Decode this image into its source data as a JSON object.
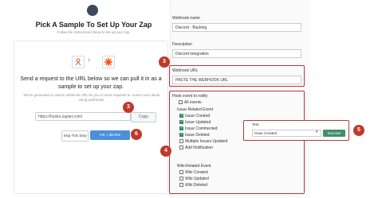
{
  "zap": {
    "title": "Pick A Sample To Set Up Your Zap",
    "subtitle": "Follow the instructions below to set up your zap.",
    "send_text": "Send a request to the URL below so we can pull it in as a sample to set up your zap.",
    "small_text": "We've generated a custom webhook URL for you to send requests to. Learn more about using webhooks.",
    "webhook_url": "https://hooks.zapier.com/",
    "copy_label": "Copy",
    "skip_label": "Skip This Step",
    "ok_label": "OK, I did this"
  },
  "form": {
    "webhook_name_label": "Webhook name",
    "webhook_name_value": "Discord - Backlog",
    "description_label": "Description",
    "description_value": "Discord integration",
    "webhook_url_label": "Webhook URL",
    "webhook_url_value": "PASTE THE WEBHOOK URL",
    "hook_event_label": "Hook event to notify",
    "all_events": "All events",
    "issue_related": "Issue-Related Event",
    "issue_events": [
      {
        "label": "Issue Created",
        "checked": true
      },
      {
        "label": "Issue Updated",
        "checked": true
      },
      {
        "label": "Issue Commented",
        "checked": true
      },
      {
        "label": "Issue Deleted",
        "checked": true
      },
      {
        "label": "Multiple Issues Updated",
        "checked": false
      },
      {
        "label": "Add Notification",
        "checked": false
      }
    ],
    "wiki_related": "Wiki-Related Event",
    "wiki_events": [
      {
        "label": "Wiki Created",
        "checked": false
      },
      {
        "label": "Wiki Updated",
        "checked": false
      },
      {
        "label": "Wiki Deleted",
        "checked": false
      }
    ]
  },
  "test": {
    "label": "Test",
    "selected": "Issue Created",
    "execute_label": "Execute"
  },
  "badges": {
    "b3": "3",
    "b4": "4",
    "b5": "5",
    "b6": "6"
  },
  "colors": {
    "badge": "#c0392b",
    "ok_button": "#4a90d9",
    "execute_button": "#3f8f6b",
    "checkbox_on": "#2e8b57"
  }
}
